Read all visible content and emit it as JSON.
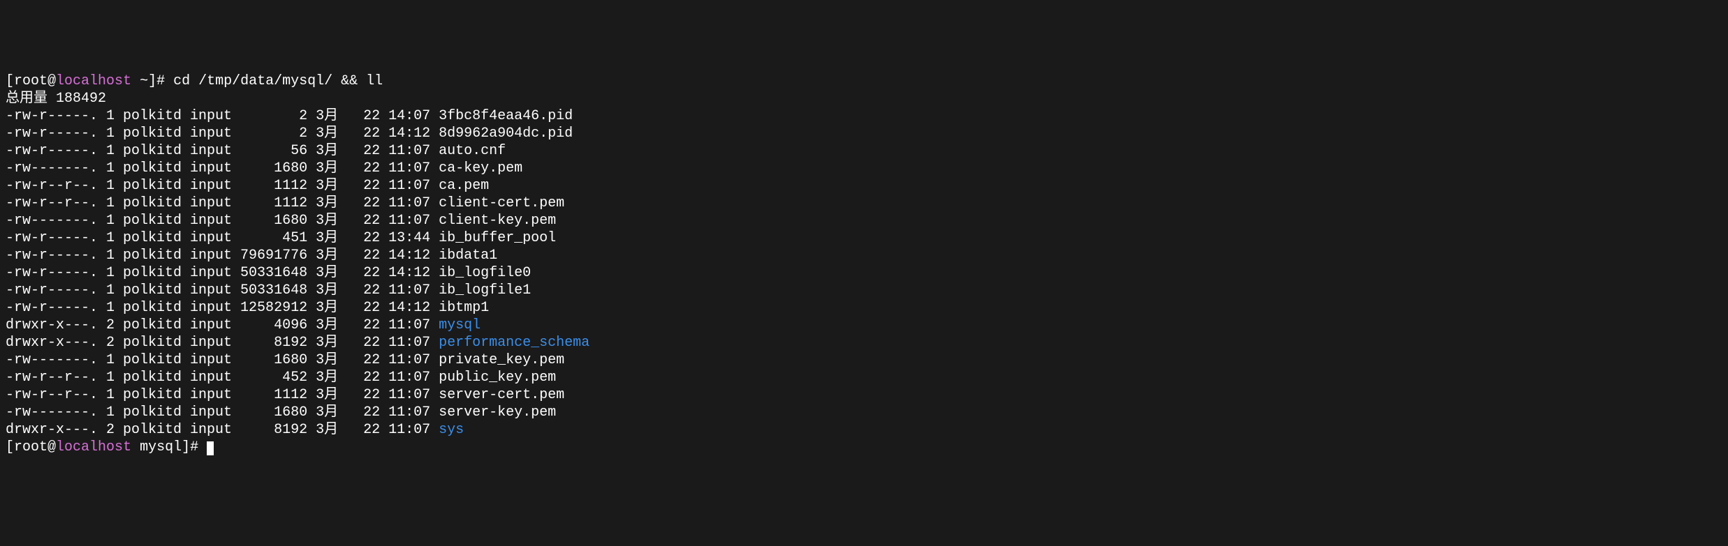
{
  "prompt1": {
    "user": "root",
    "at": "@",
    "host": "localhost",
    "path": " ~",
    "command": "cd /tmp/data/mysql/ && ll"
  },
  "total": "总用量 188492",
  "rows": [
    {
      "perm": "-rw-r-----.",
      "links": "1",
      "owner": "polkitd",
      "group": "input",
      "size": "       2",
      "month": "3月",
      "day": "  22",
      "time": "14:07",
      "name": "3fbc8f4eaa46.pid",
      "dir": false
    },
    {
      "perm": "-rw-r-----.",
      "links": "1",
      "owner": "polkitd",
      "group": "input",
      "size": "       2",
      "month": "3月",
      "day": "  22",
      "time": "14:12",
      "name": "8d9962a904dc.pid",
      "dir": false
    },
    {
      "perm": "-rw-r-----.",
      "links": "1",
      "owner": "polkitd",
      "group": "input",
      "size": "      56",
      "month": "3月",
      "day": "  22",
      "time": "11:07",
      "name": "auto.cnf",
      "dir": false
    },
    {
      "perm": "-rw-------.",
      "links": "1",
      "owner": "polkitd",
      "group": "input",
      "size": "    1680",
      "month": "3月",
      "day": "  22",
      "time": "11:07",
      "name": "ca-key.pem",
      "dir": false
    },
    {
      "perm": "-rw-r--r--.",
      "links": "1",
      "owner": "polkitd",
      "group": "input",
      "size": "    1112",
      "month": "3月",
      "day": "  22",
      "time": "11:07",
      "name": "ca.pem",
      "dir": false
    },
    {
      "perm": "-rw-r--r--.",
      "links": "1",
      "owner": "polkitd",
      "group": "input",
      "size": "    1112",
      "month": "3月",
      "day": "  22",
      "time": "11:07",
      "name": "client-cert.pem",
      "dir": false
    },
    {
      "perm": "-rw-------.",
      "links": "1",
      "owner": "polkitd",
      "group": "input",
      "size": "    1680",
      "month": "3月",
      "day": "  22",
      "time": "11:07",
      "name": "client-key.pem",
      "dir": false
    },
    {
      "perm": "-rw-r-----.",
      "links": "1",
      "owner": "polkitd",
      "group": "input",
      "size": "     451",
      "month": "3月",
      "day": "  22",
      "time": "13:44",
      "name": "ib_buffer_pool",
      "dir": false
    },
    {
      "perm": "-rw-r-----.",
      "links": "1",
      "owner": "polkitd",
      "group": "input",
      "size": "79691776",
      "month": "3月",
      "day": "  22",
      "time": "14:12",
      "name": "ibdata1",
      "dir": false
    },
    {
      "perm": "-rw-r-----.",
      "links": "1",
      "owner": "polkitd",
      "group": "input",
      "size": "50331648",
      "month": "3月",
      "day": "  22",
      "time": "14:12",
      "name": "ib_logfile0",
      "dir": false
    },
    {
      "perm": "-rw-r-----.",
      "links": "1",
      "owner": "polkitd",
      "group": "input",
      "size": "50331648",
      "month": "3月",
      "day": "  22",
      "time": "11:07",
      "name": "ib_logfile1",
      "dir": false
    },
    {
      "perm": "-rw-r-----.",
      "links": "1",
      "owner": "polkitd",
      "group": "input",
      "size": "12582912",
      "month": "3月",
      "day": "  22",
      "time": "14:12",
      "name": "ibtmp1",
      "dir": false
    },
    {
      "perm": "drwxr-x---.",
      "links": "2",
      "owner": "polkitd",
      "group": "input",
      "size": "    4096",
      "month": "3月",
      "day": "  22",
      "time": "11:07",
      "name": "mysql",
      "dir": true
    },
    {
      "perm": "drwxr-x---.",
      "links": "2",
      "owner": "polkitd",
      "group": "input",
      "size": "    8192",
      "month": "3月",
      "day": "  22",
      "time": "11:07",
      "name": "performance_schema",
      "dir": true
    },
    {
      "perm": "-rw-------.",
      "links": "1",
      "owner": "polkitd",
      "group": "input",
      "size": "    1680",
      "month": "3月",
      "day": "  22",
      "time": "11:07",
      "name": "private_key.pem",
      "dir": false
    },
    {
      "perm": "-rw-r--r--.",
      "links": "1",
      "owner": "polkitd",
      "group": "input",
      "size": "     452",
      "month": "3月",
      "day": "  22",
      "time": "11:07",
      "name": "public_key.pem",
      "dir": false
    },
    {
      "perm": "-rw-r--r--.",
      "links": "1",
      "owner": "polkitd",
      "group": "input",
      "size": "    1112",
      "month": "3月",
      "day": "  22",
      "time": "11:07",
      "name": "server-cert.pem",
      "dir": false
    },
    {
      "perm": "-rw-------.",
      "links": "1",
      "owner": "polkitd",
      "group": "input",
      "size": "    1680",
      "month": "3月",
      "day": "  22",
      "time": "11:07",
      "name": "server-key.pem",
      "dir": false
    },
    {
      "perm": "drwxr-x---.",
      "links": "2",
      "owner": "polkitd",
      "group": "input",
      "size": "    8192",
      "month": "3月",
      "day": "  22",
      "time": "11:07",
      "name": "sys",
      "dir": true
    }
  ],
  "prompt2": {
    "user": "root",
    "at": "@",
    "host": "localhost",
    "path": " mysql"
  }
}
